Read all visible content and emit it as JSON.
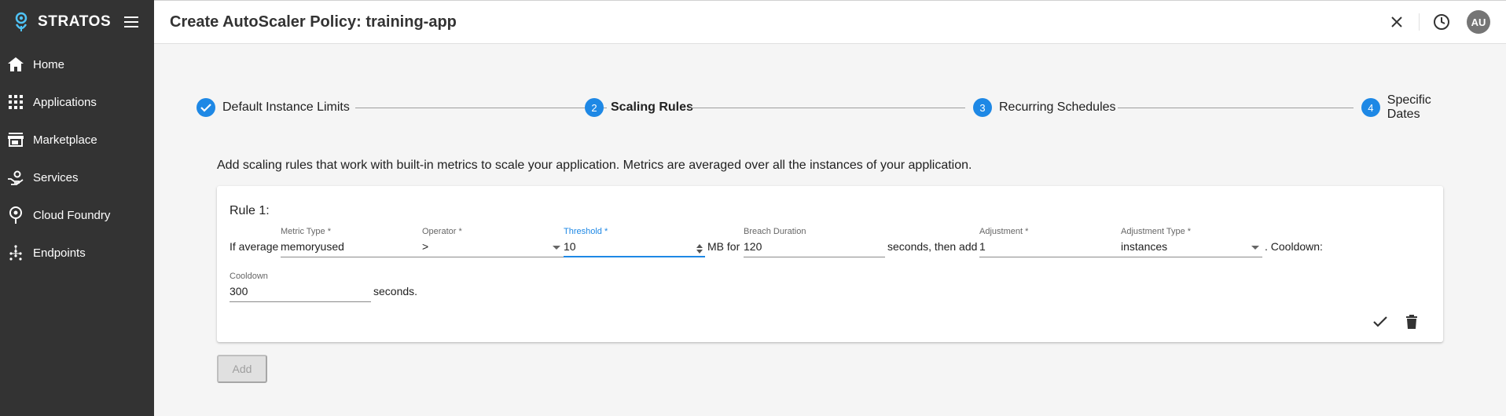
{
  "app": {
    "brand": "STRATOS"
  },
  "sidebar": {
    "items": [
      {
        "label": "Home",
        "icon": "home-icon"
      },
      {
        "label": "Applications",
        "icon": "apps-grid-icon"
      },
      {
        "label": "Marketplace",
        "icon": "store-icon"
      },
      {
        "label": "Services",
        "icon": "service-icon"
      },
      {
        "label": "Cloud Foundry",
        "icon": "cloud-foundry-icon"
      },
      {
        "label": "Endpoints",
        "icon": "endpoints-icon"
      }
    ]
  },
  "header": {
    "title": "Create AutoScaler Policy: training-app",
    "avatar": "AU"
  },
  "stepper": {
    "steps": [
      {
        "label": "Default Instance Limits",
        "number": "1",
        "state": "completed"
      },
      {
        "label": "Scaling Rules",
        "number": "2",
        "state": "active"
      },
      {
        "label": "Recurring Schedules",
        "number": "3",
        "state": "pending"
      },
      {
        "label": "Specific Dates",
        "number": "4",
        "state": "pending"
      }
    ]
  },
  "description": "Add scaling rules that work with built-in metrics to scale your application. Metrics are averaged over all the instances of your application.",
  "rule": {
    "title": "Rule 1:",
    "prefix": "If average",
    "metric_type": {
      "label": "Metric Type *",
      "value": "memoryused"
    },
    "operator": {
      "label": "Operator *",
      "value": ">"
    },
    "threshold": {
      "label": "Threshold *",
      "value": "10"
    },
    "unit_text": "MB for",
    "breach_duration": {
      "label": "Breach Duration",
      "value": "120"
    },
    "seconds_then_add": "seconds, then add",
    "adjustment": {
      "label": "Adjustment *",
      "value": "1"
    },
    "adjustment_type": {
      "label": "Adjustment Type *",
      "value": "instances"
    },
    "cooldown_text": ". Cooldown:",
    "cooldown": {
      "label": "Cooldown",
      "value": "300"
    },
    "seconds_end": "seconds."
  },
  "add_button": "Add",
  "colors": {
    "sidebar": "#333333",
    "accent": "#1e88e5",
    "background": "#f5f5f5"
  }
}
